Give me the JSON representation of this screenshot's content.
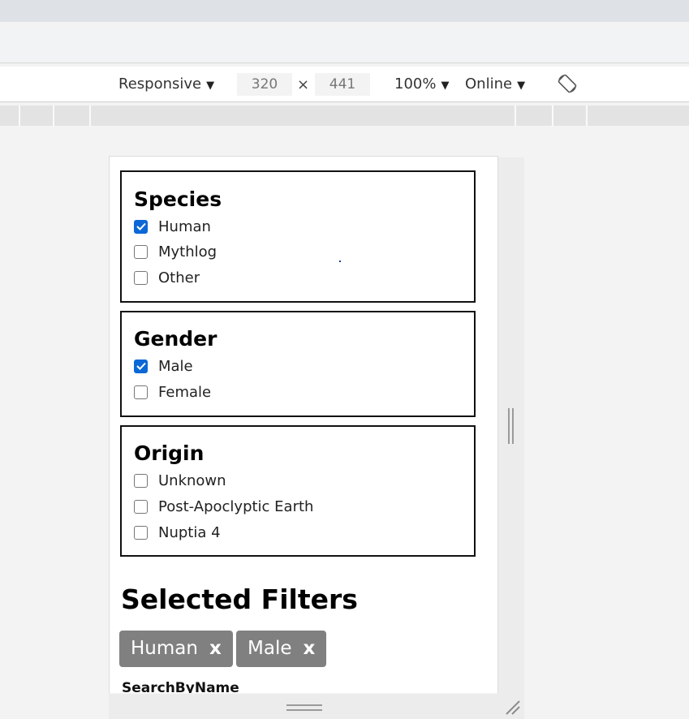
{
  "devtools": {
    "device_label": "Responsive",
    "width_value": "320",
    "times": "×",
    "height_value": "441",
    "zoom_label": "100%",
    "network_label": "Online",
    "caret": "▼"
  },
  "filters": {
    "species": {
      "title": "Species",
      "options": [
        {
          "label": "Human",
          "checked": true
        },
        {
          "label": "Mythlog",
          "checked": false
        },
        {
          "label": "Other",
          "checked": false
        }
      ]
    },
    "gender": {
      "title": "Gender",
      "options": [
        {
          "label": "Male",
          "checked": true
        },
        {
          "label": "Female",
          "checked": false
        }
      ]
    },
    "origin": {
      "title": "Origin",
      "options": [
        {
          "label": "Unknown",
          "checked": false
        },
        {
          "label": "Post-Apoclyptic Earth",
          "checked": false
        },
        {
          "label": "Nuptia 4",
          "checked": false
        }
      ]
    }
  },
  "selected": {
    "heading": "Selected Filters",
    "chips": [
      {
        "label": "Human",
        "remove": "x"
      },
      {
        "label": "Male",
        "remove": "x"
      }
    ]
  },
  "search": {
    "label": "SearchByName"
  },
  "colors": {
    "checkbox_accent": "#0b68d6",
    "chip_bg": "#808080"
  }
}
